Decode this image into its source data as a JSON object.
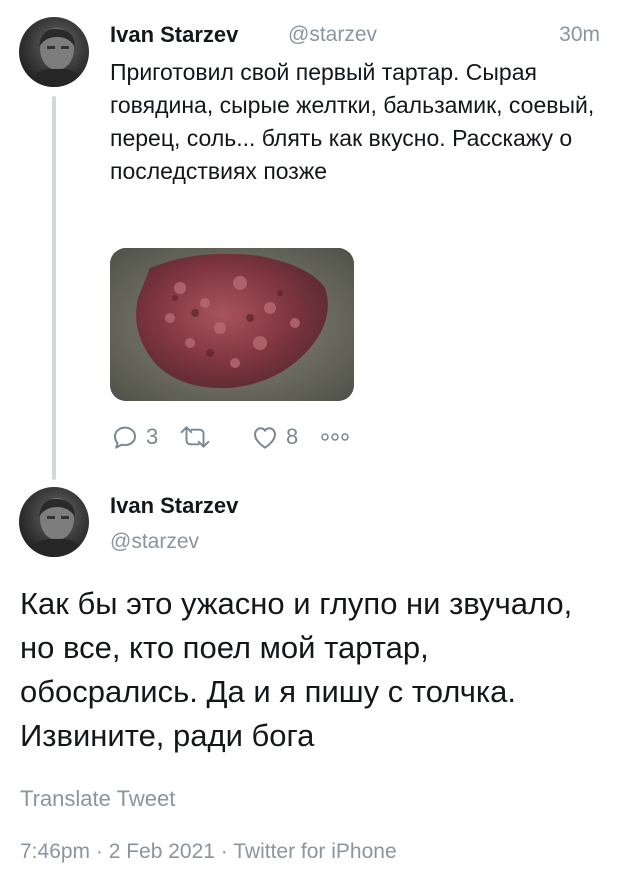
{
  "tweet1": {
    "author_name": "Ivan Starzev",
    "handle": "@starzev",
    "time": "30m",
    "text": "Приготовил свой первый тартар. Сырая говядина, сырые желтки, бальзамик, соевый, перец, соль... блять как вкусно. Расскажу о последствиях позже",
    "reply_count": "3",
    "retweet_count": "",
    "like_count": "8",
    "icons": {
      "reply": "reply-icon",
      "retweet": "retweet-icon",
      "like": "heart-icon",
      "more": "more-icon"
    }
  },
  "tweet2": {
    "author_name": "Ivan Starzev",
    "handle": "@starzev",
    "text": "Как бы это ужасно и глупо ни звучало, но все, кто поел мой тартар, обосрались. Да и я пишу с толчка. Извините, ради бога",
    "translate_label": "Translate Tweet",
    "timestamp": "7:46pm · 2 Feb 2021 · Twitter for iPhone"
  },
  "colors": {
    "text": "#14171a",
    "secondary": "#8a959e",
    "thread_line": "#cfd9de"
  }
}
